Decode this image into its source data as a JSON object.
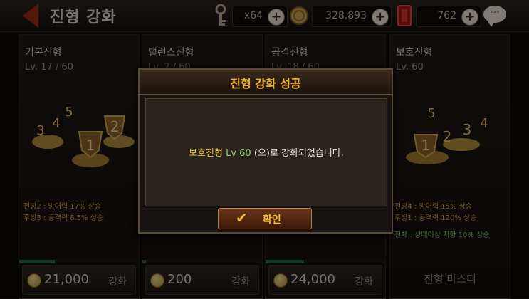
{
  "header": {
    "title": "진형 강화",
    "resources": [
      {
        "icon": "key-icon",
        "value": "x64"
      },
      {
        "icon": "gold-coin-icon",
        "value": "328,893"
      },
      {
        "icon": "ruby-gem-icon",
        "value": "762"
      }
    ],
    "plus": "+"
  },
  "panels": [
    {
      "name": "기본진형",
      "level": "Lv. 17 / 60",
      "effects": [
        "전방2 : 방어력 17% 상승",
        "후방3 : 공격력 8.5% 상승"
      ],
      "progress": 0.3,
      "cost": "21,000",
      "action": "강화"
    },
    {
      "name": "밸런스진형",
      "level": "Lv. 2 / 60",
      "effects": [],
      "progress": 0.03,
      "cost": "200",
      "action": "강화"
    },
    {
      "name": "공격진형",
      "level": "Lv. 18 / 60",
      "effects": [],
      "progress": 0.32,
      "cost": "24,000",
      "action": "강화"
    },
    {
      "name": "보호진형",
      "level": "Lv. 60",
      "effects": [
        "전방4 : 방어력 15% 상승",
        "후방1 : 공격력 120% 상승"
      ],
      "effect_green": "전체 : 상태이상 저항 10% 상승",
      "master": "진형 마스터"
    }
  ],
  "dialog": {
    "title": "진형 강화 성공",
    "msg_name": "보호진형",
    "msg_lv": "Lv 60",
    "msg_rest": " (으)로 강화되었습니다.",
    "confirm": "확인"
  },
  "colors": {
    "accent_gold": "#f0c030",
    "level_green": "#98d060",
    "effect_gold": "#d4a448"
  }
}
